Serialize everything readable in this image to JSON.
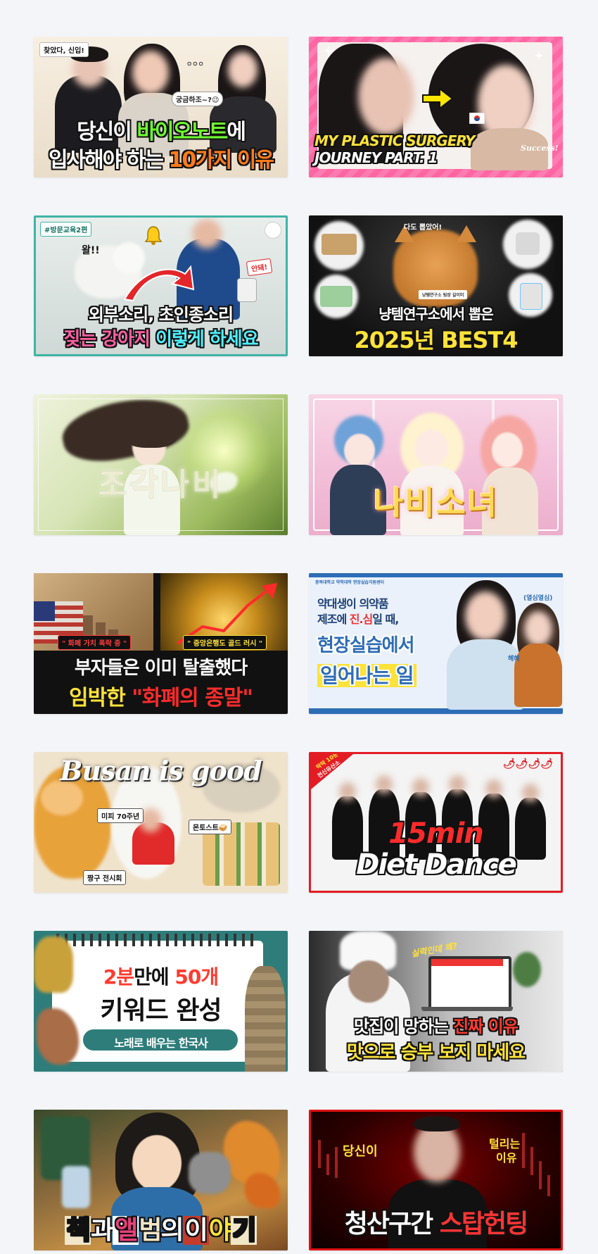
{
  "thumbnails": [
    {
      "id": "bionote",
      "tag_top": "찾았다, 신입!",
      "bubble": "궁금하조~?😉",
      "dots": "ㅇㅇㅇ",
      "line1_a": "당신이 ",
      "line1_b": "바이오노트",
      "line1_c": "에",
      "line2_a": "입사해야 하는 ",
      "line2_b": "10가지 이유"
    },
    {
      "id": "plastic-surgery",
      "line1": "MY PLASTIC SURGERY",
      "line2": "JOURNEY PART. 1",
      "badge": "Success!"
    },
    {
      "id": "dog-training",
      "hashtag": "#방문교육2편",
      "bark1": "왈!!",
      "bark2": "안돼!",
      "line1": "외부소리, 초인종소리",
      "line2_a": "짖는 강아지 ",
      "line2_b": "이렇게 하세요"
    },
    {
      "id": "cat-best4",
      "cat_caption": "다도 뽑았어!",
      "cat_tag": "냥템연구소 팀장 길이미",
      "line1": "냥템연구소에서 뽑은",
      "line2": "2025년 BEST4"
    },
    {
      "id": "jogak-nabi",
      "title": "조각나비"
    },
    {
      "id": "nabi-sonyeo",
      "title": "나비소녀"
    },
    {
      "id": "currency-end",
      "tag1": "\" 화폐 가치 폭락 중 \"",
      "tag2": "\" 중앙은행도 골드 러시 \"",
      "line1": "부자들은 이미 탈출했다",
      "line2_a": "임박한 ",
      "line2_b": "\"화폐의 종말\""
    },
    {
      "id": "pharmacy-practice",
      "org": "충북대학교 약학대학 현장실습지원센터",
      "line1_a": "약대생이 의약품",
      "line2_a": "제조에 ",
      "line2_b": "진.심",
      "line2_c": "일 때,",
      "line3": "현장실습에서",
      "line4": "일어나는 일",
      "label1": "(열심열심)",
      "label2": "헤헤"
    },
    {
      "id": "busan",
      "title": "Busan is good",
      "label1": "미피 70주년",
      "label2": "몬토스트🥪",
      "label3": "짱구 전시회"
    },
    {
      "id": "diet-dance",
      "corner_a": "딱딱 10분",
      "corner_b": "전신유산소",
      "peppers": "🌶🌶🌶🌶",
      "line1": "15min",
      "line2": "Diet Dance"
    },
    {
      "id": "korean-history",
      "line1_a": "2분",
      "line1_b": "만에 ",
      "line1_c": "50개",
      "line2": "키워드 완성",
      "pill": "노래로 배우는 한국사"
    },
    {
      "id": "restaurant",
      "bubble": "실력인데 왜?",
      "line1_a": "맛집이 망하는 ",
      "line1_b": "진짜 이유",
      "line2": "맛으로 승부 보지 마세요"
    },
    {
      "id": "book-album",
      "c1": "책",
      "c2": "과",
      "c3": "앨",
      "c4": "범",
      "c5": "의",
      "c6": "이",
      "c7": "야",
      "c8": "기"
    },
    {
      "id": "liquidation",
      "left": "당신이",
      "right_1": "털리는",
      "right_2": "이유",
      "line_a": "청산구간 ",
      "line_b": "스탑헌팅"
    }
  ],
  "colors": {
    "page_bg": "#f4f5f9",
    "neon_green": "#6dff2e",
    "pink": "#ff5fa2",
    "yellow": "#ffe23a",
    "red": "#ff2b2b",
    "teal_blue": "#2d6db5"
  },
  "icons": [
    "bell-icon",
    "cursor-arrow-icon",
    "sparkle-icon",
    "korean-flag-icon",
    "pepper-icon",
    "spiral-binding-icon",
    "red-arrow-icon"
  ]
}
